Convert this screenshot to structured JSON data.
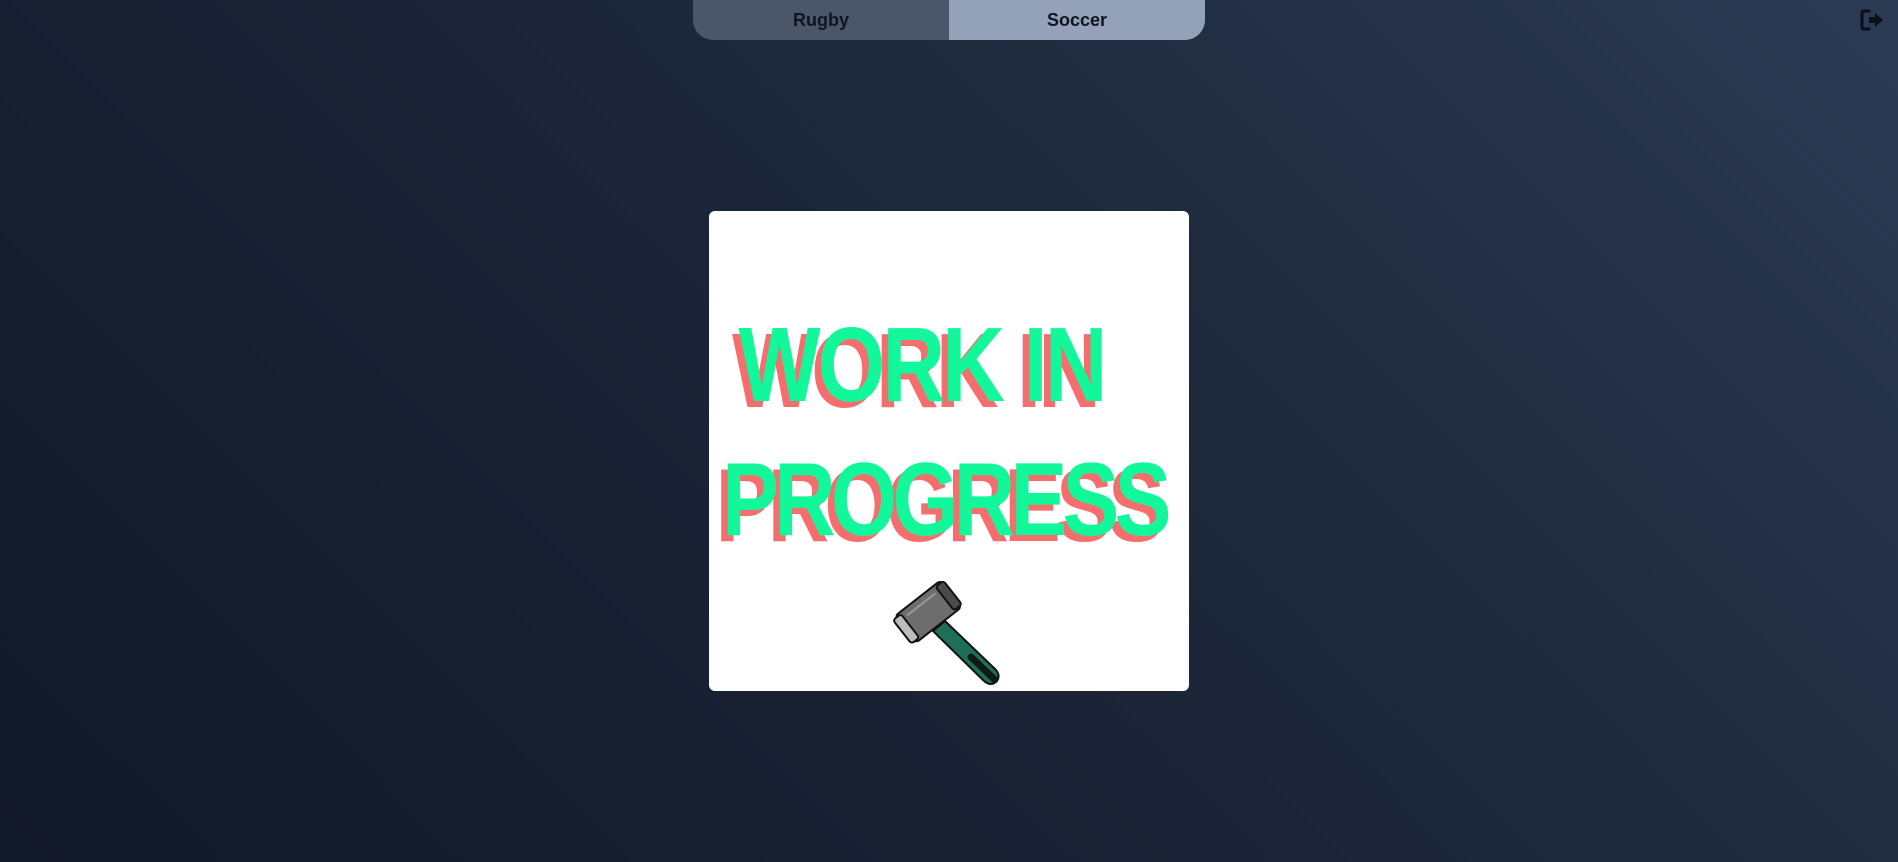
{
  "tabs": [
    {
      "label": "Rugby",
      "active": false
    },
    {
      "label": "Soccer",
      "active": true
    }
  ],
  "header": {
    "logout_icon": "logout-icon"
  },
  "main": {
    "image": {
      "line1": "WORK IN",
      "line2": "PROGRESS",
      "icon": "hammer-icon",
      "text_color": "#12f79a",
      "shadow_color": "#f56e6e"
    }
  },
  "colors": {
    "tab_inactive": "#4b5669",
    "tab_active": "#94a2b9",
    "background_dark": "#111827",
    "background_light": "#2c3b55"
  }
}
